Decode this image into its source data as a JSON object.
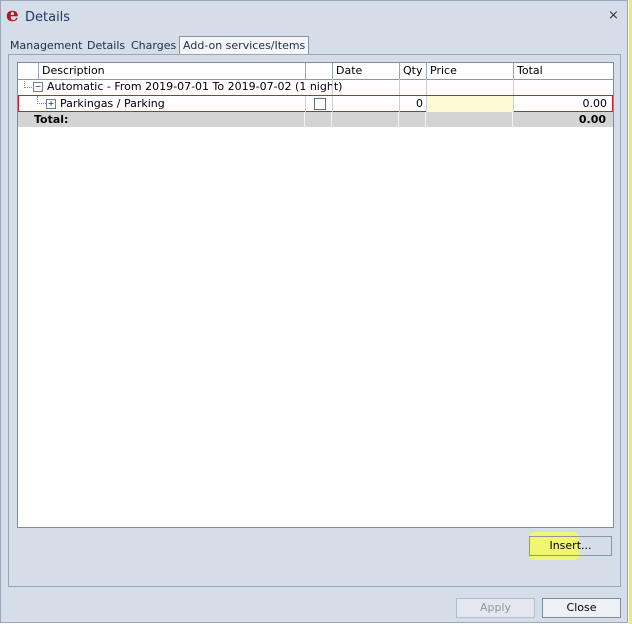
{
  "window": {
    "title": "Details",
    "logo_letter": "e"
  },
  "tabs": [
    {
      "label": "Management"
    },
    {
      "label": "Details"
    },
    {
      "label": "Charges"
    },
    {
      "label": "Add-on services/Items",
      "active": true
    }
  ],
  "grid": {
    "columns": [
      "Description",
      "",
      "Date",
      "Qty",
      "Price",
      "Total"
    ],
    "group_row": {
      "description": "Automatic - From 2019-07-01 To 2019-07-02 (1 night)"
    },
    "item_row": {
      "description": "Parkingas / Parking",
      "checked": false,
      "date": "",
      "qty": "0",
      "price": "",
      "total": "0.00"
    },
    "total_row": {
      "label": "Total:",
      "total": "0.00"
    }
  },
  "buttons": {
    "insert": "Insert...",
    "apply": "Apply",
    "close": "Close"
  },
  "colors": {
    "selection_border": "#c82232",
    "highlight": "#f3f56a",
    "price_cell_bg": "#fdfad6",
    "logo": "#b0142c"
  }
}
